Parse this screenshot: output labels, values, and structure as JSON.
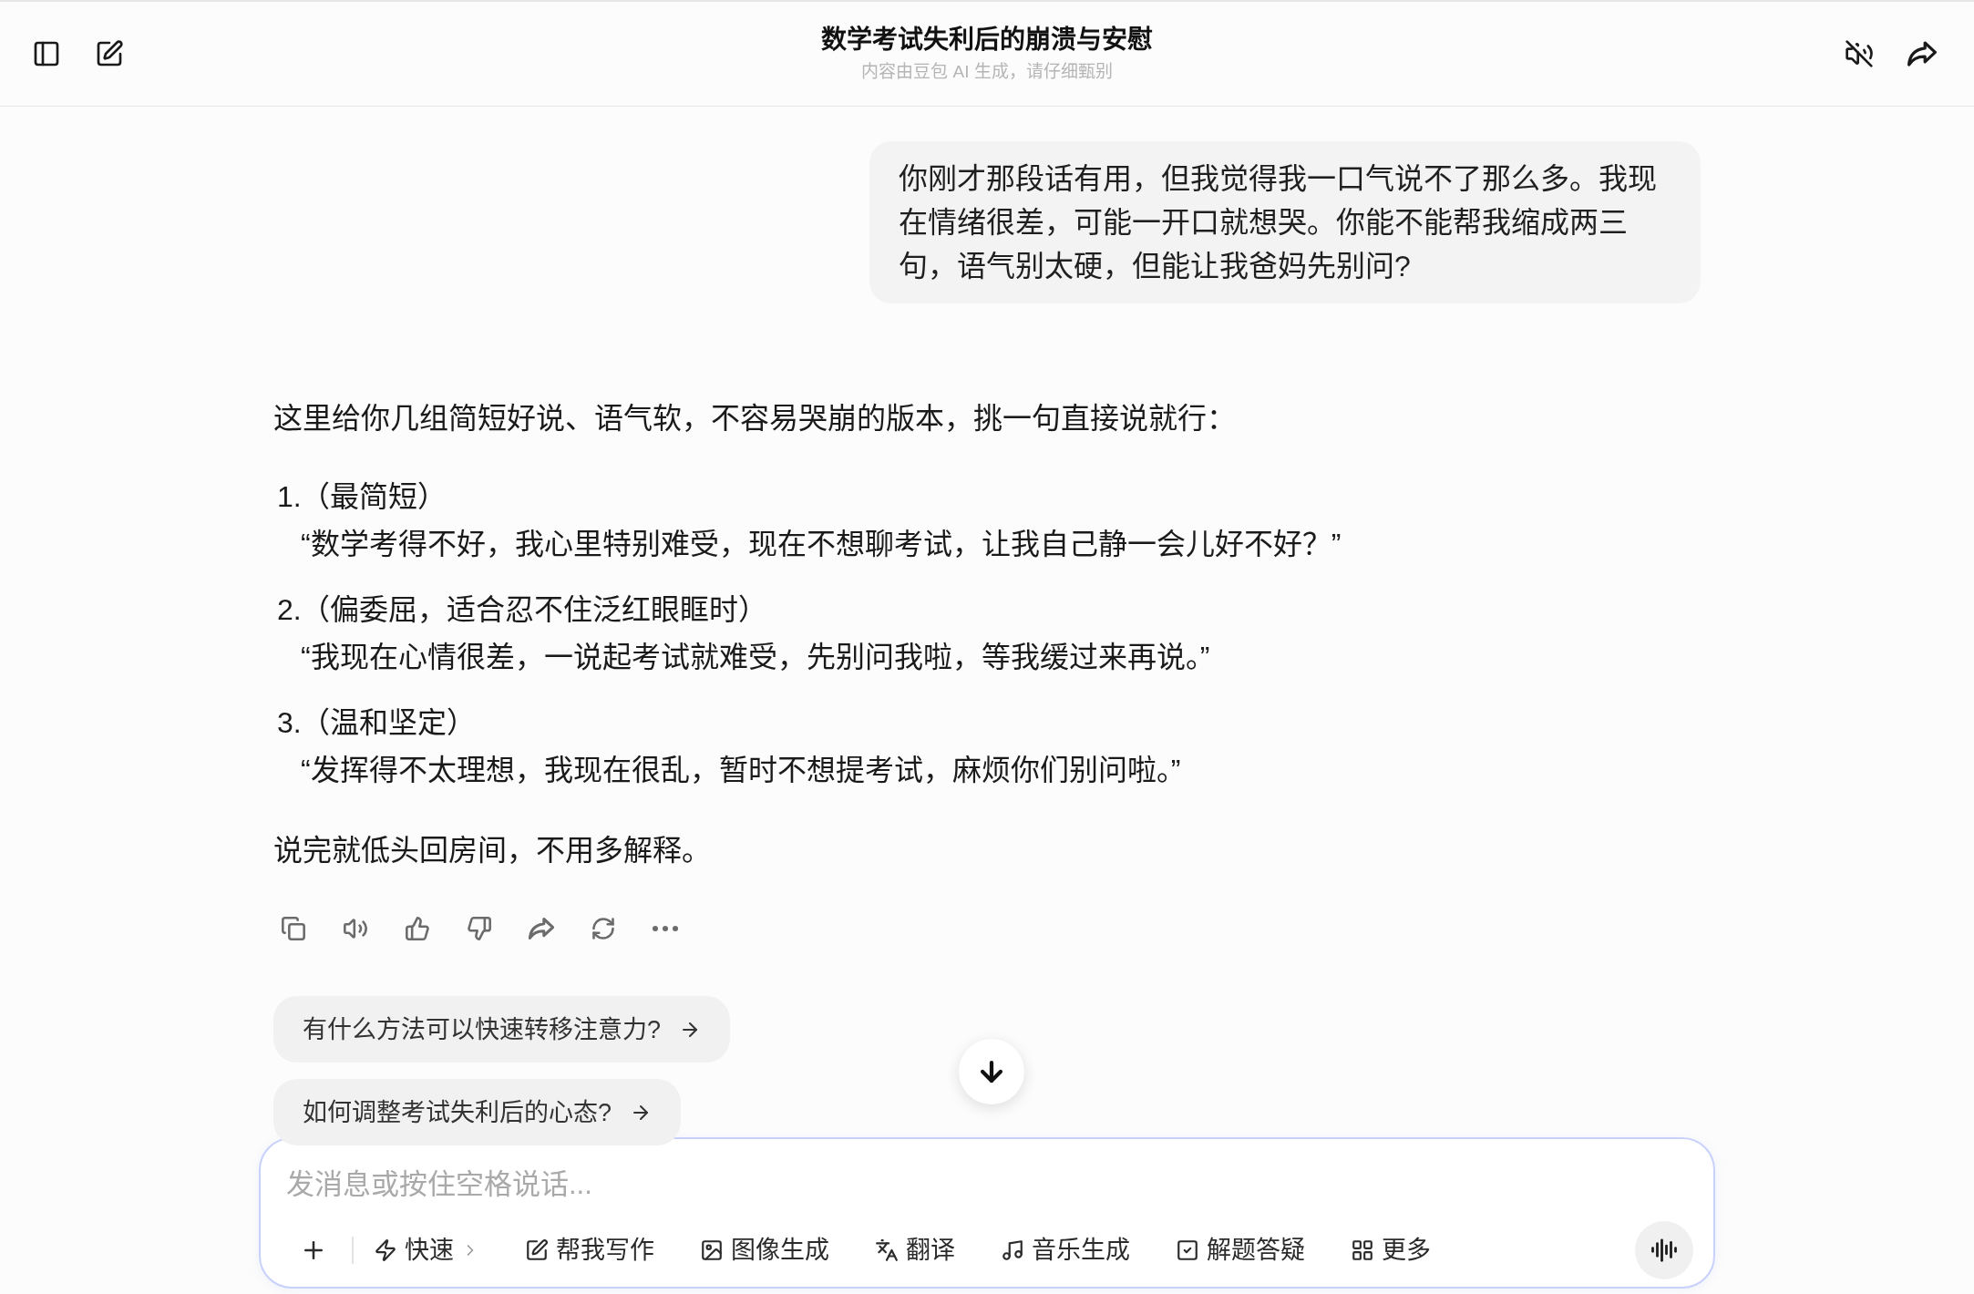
{
  "header": {
    "title": "数学考试失利后的崩溃与安慰",
    "subtitle": "内容由豆包 AI 生成，请仔细甄别"
  },
  "messages": [
    {
      "kind": "user",
      "text": "你刚才那段话有用，但我觉得我一口气说不了那么多。我现在情绪很差，可能一开口就想哭。你能不能帮我缩成两三句，语气别太硬，但能让我爸妈先别问?"
    },
    {
      "kind": "assistant",
      "intro": "这里给你几组简短好说、语气软，不容易哭崩的版本，挑一句直接说就行：",
      "options": [
        {
          "number": "1.",
          "label": "（最简短）",
          "quote": "“数学考得不好，我心里特别难受，现在不想聊考试，让我自己静一会儿好不好？”"
        },
        {
          "number": "2.",
          "label": "（偏委屈，适合忍不住泛红眼眶时）",
          "quote": "“我现在心情很差，一说起考试就难受，先别问我啦，等我缓过来再说。”"
        },
        {
          "number": "3.",
          "label": "（温和坚定）",
          "quote": "“发挥得不太理想，我现在很乱，暂时不想提考试，麻烦你们别问啦。”"
        }
      ],
      "closing": "说完就低头回房间，不用多解释。"
    }
  ],
  "suggestions": [
    {
      "text": "有什么方法可以快速转移注意力?"
    },
    {
      "text": "如何调整考试失利后的心态?"
    }
  ],
  "composer": {
    "placeholder": "发消息或按住空格说话...",
    "tools": [
      {
        "label": "快速",
        "kind": "menu"
      },
      {
        "label": "帮我写作",
        "kind": "action"
      },
      {
        "label": "图像生成",
        "kind": "action"
      },
      {
        "label": "翻译",
        "kind": "action"
      },
      {
        "label": "音乐生成",
        "kind": "action"
      },
      {
        "label": "解题答疑",
        "kind": "action"
      },
      {
        "label": "更多",
        "kind": "action"
      }
    ]
  }
}
